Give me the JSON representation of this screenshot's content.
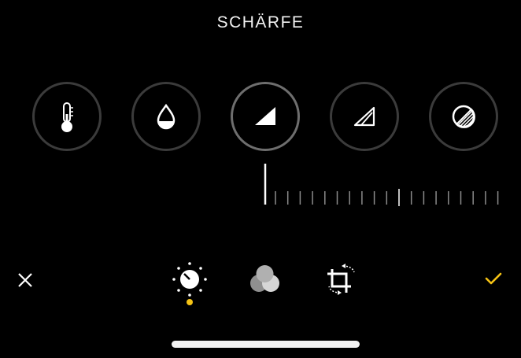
{
  "header": {
    "title": "SCHÄRFE"
  },
  "adjustments": [
    {
      "icon": "thermometer-icon",
      "name": "tool-warmth"
    },
    {
      "icon": "droplet-icon",
      "name": "tool-tint"
    },
    {
      "icon": "sharpness-triangle-icon",
      "name": "tool-sharpness",
      "active": true
    },
    {
      "icon": "definition-triangle-outline-icon",
      "name": "tool-definition"
    },
    {
      "icon": "noise-reduction-circle-icon",
      "name": "tool-noise-reduction"
    }
  ],
  "toolbar": {
    "cancel": "close-icon",
    "adjust": "adjust-dial-icon",
    "filters": "filters-circles-icon",
    "crop": "crop-rotate-icon",
    "done": "checkmark-icon"
  },
  "colors": {
    "accent": "#f5c315",
    "ring": "#3b3b3b",
    "active_ring": "#6e6e6e",
    "tick": "#8c8c8c"
  }
}
